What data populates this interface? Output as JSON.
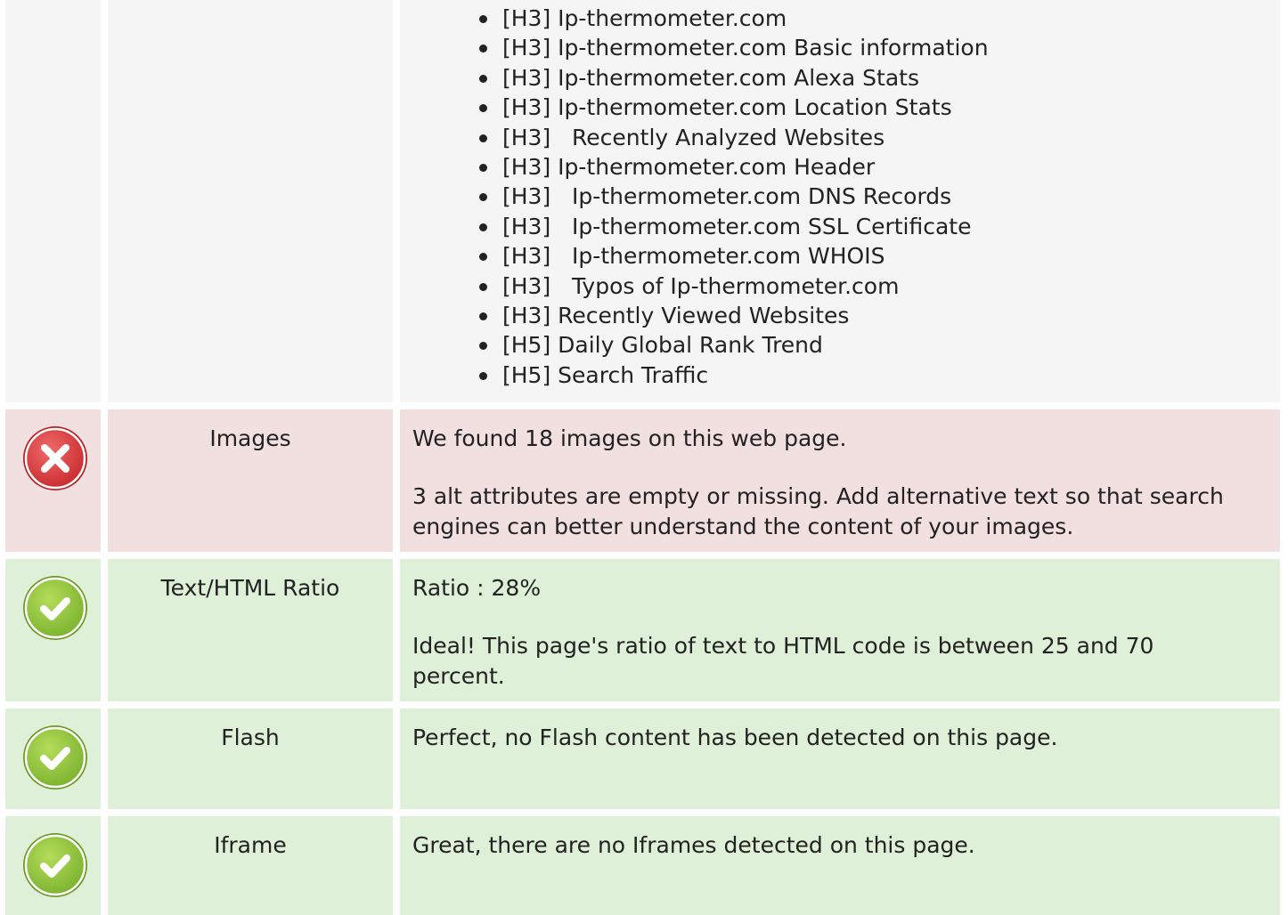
{
  "headings": {
    "items": [
      "[H3] Ip-thermometer.com",
      "[H3] Ip-thermometer.com Basic information",
      "[H3] Ip-thermometer.com Alexa Stats",
      "[H3] Ip-thermometer.com Location Stats",
      "[H3]   Recently Analyzed Websites",
      "[H3] Ip-thermometer.com Header",
      "[H3]   Ip-thermometer.com DNS Records",
      "[H3]   Ip-thermometer.com SSL Certificate",
      "[H3]   Ip-thermometer.com WHOIS",
      "[H3]   Typos of Ip-thermometer.com",
      "[H3] Recently Viewed Websites",
      "[H5] Daily Global Rank Trend",
      "[H5] Search Traffic"
    ]
  },
  "rows": {
    "images": {
      "status": "error",
      "status_icon": "error-x-icon",
      "title": "Images",
      "line1": "We found 18 images on this web page.",
      "line2": "3 alt attributes are empty or missing. Add alternative text so that search engines can better understand the content of your images."
    },
    "text_html_ratio": {
      "status": "ok",
      "status_icon": "success-check-icon",
      "title": "Text/HTML Ratio",
      "line1": "Ratio : 28%",
      "line2": "Ideal! This page's ratio of text to HTML code is between 25 and 70 percent."
    },
    "flash": {
      "status": "ok",
      "status_icon": "success-check-icon",
      "title": "Flash",
      "line1": "Perfect, no Flash content has been detected on this page."
    },
    "iframe": {
      "status": "ok",
      "status_icon": "success-check-icon",
      "title": "Iframe",
      "line1": "Great, there are no Iframes detected on this page."
    }
  },
  "colors": {
    "error_bg": "#f2dfe0",
    "ok_bg": "#dff0d8",
    "neutral_bg": "#f5f5f5",
    "error_icon": "#d9383a",
    "ok_icon": "#8cc43c"
  }
}
